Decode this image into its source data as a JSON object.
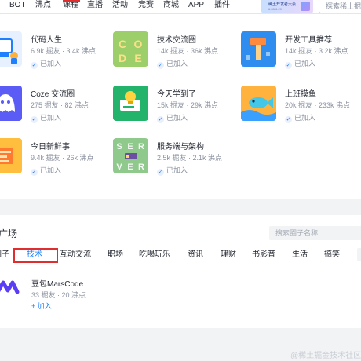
{
  "nav": {
    "items": [
      "BOT",
      "沸点",
      "课程",
      "直播",
      "活动",
      "竞赛",
      "商城",
      "APP",
      "插件"
    ],
    "banner_title": "稀土开发者大会",
    "banner_date": "6.28-6.29",
    "search_placeholder": "探索稀土掘金"
  },
  "circles": [
    {
      "name": "代码人生",
      "stats": "6.9k 掘友 · 3.4k 沸点",
      "status": "已加入",
      "icon": "code-life-icon"
    },
    {
      "name": "技术交流圈",
      "stats": "14k 掘友 · 36k 沸点",
      "status": "已加入",
      "icon": "code-letters-icon",
      "thumb_text": [
        "C",
        "O",
        "D",
        "E"
      ]
    },
    {
      "name": "开发工具推荐",
      "stats": "14k 掘友 · 3.2k 沸点",
      "status": "已加入",
      "icon": "hammer-icon"
    },
    {
      "name": "Coze 交流圈",
      "stats": "275 掘友 · 82 沸点",
      "status": "已加入",
      "icon": "coze-icon"
    },
    {
      "name": "今天学到了",
      "stats": "15k 掘友 · 29k 沸点",
      "status": "已加入",
      "icon": "lightbulb-icon"
    },
    {
      "name": "上班摸鱼",
      "stats": "20k 掘友 · 233k 沸点",
      "status": "已加入",
      "icon": "fish-icon"
    },
    {
      "name": "今日新鲜事",
      "stats": "9.4k 掘友 · 26k 沸点",
      "status": "已加入",
      "icon": "news-icon"
    },
    {
      "name": "服务端与架构",
      "stats": "2.5k 掘友 · 2.1k 沸点",
      "status": "已加入",
      "icon": "server-icon",
      "thumb_text": [
        "S",
        "E",
        "R",
        "V",
        "E",
        "R"
      ]
    }
  ],
  "square": {
    "title": "广场",
    "search_placeholder": "搜索圈子名称",
    "tabs": [
      "圈子",
      "技术",
      "互动交流",
      "职场",
      "吃喝玩乐",
      "资讯",
      "理财",
      "书影音",
      "生活",
      "搞笑"
    ],
    "active_tab": "技术",
    "item": {
      "name": "豆包MarsCode",
      "stats": "33 掘友 · 20 沸点",
      "join_label": "+ 加入"
    }
  },
  "watermark": "@稀土掘金技术社区",
  "colors": {
    "accent": "#1e80ff",
    "highlight_box": "#e02d2d",
    "muted": "#8a919f",
    "text": "#252933"
  }
}
